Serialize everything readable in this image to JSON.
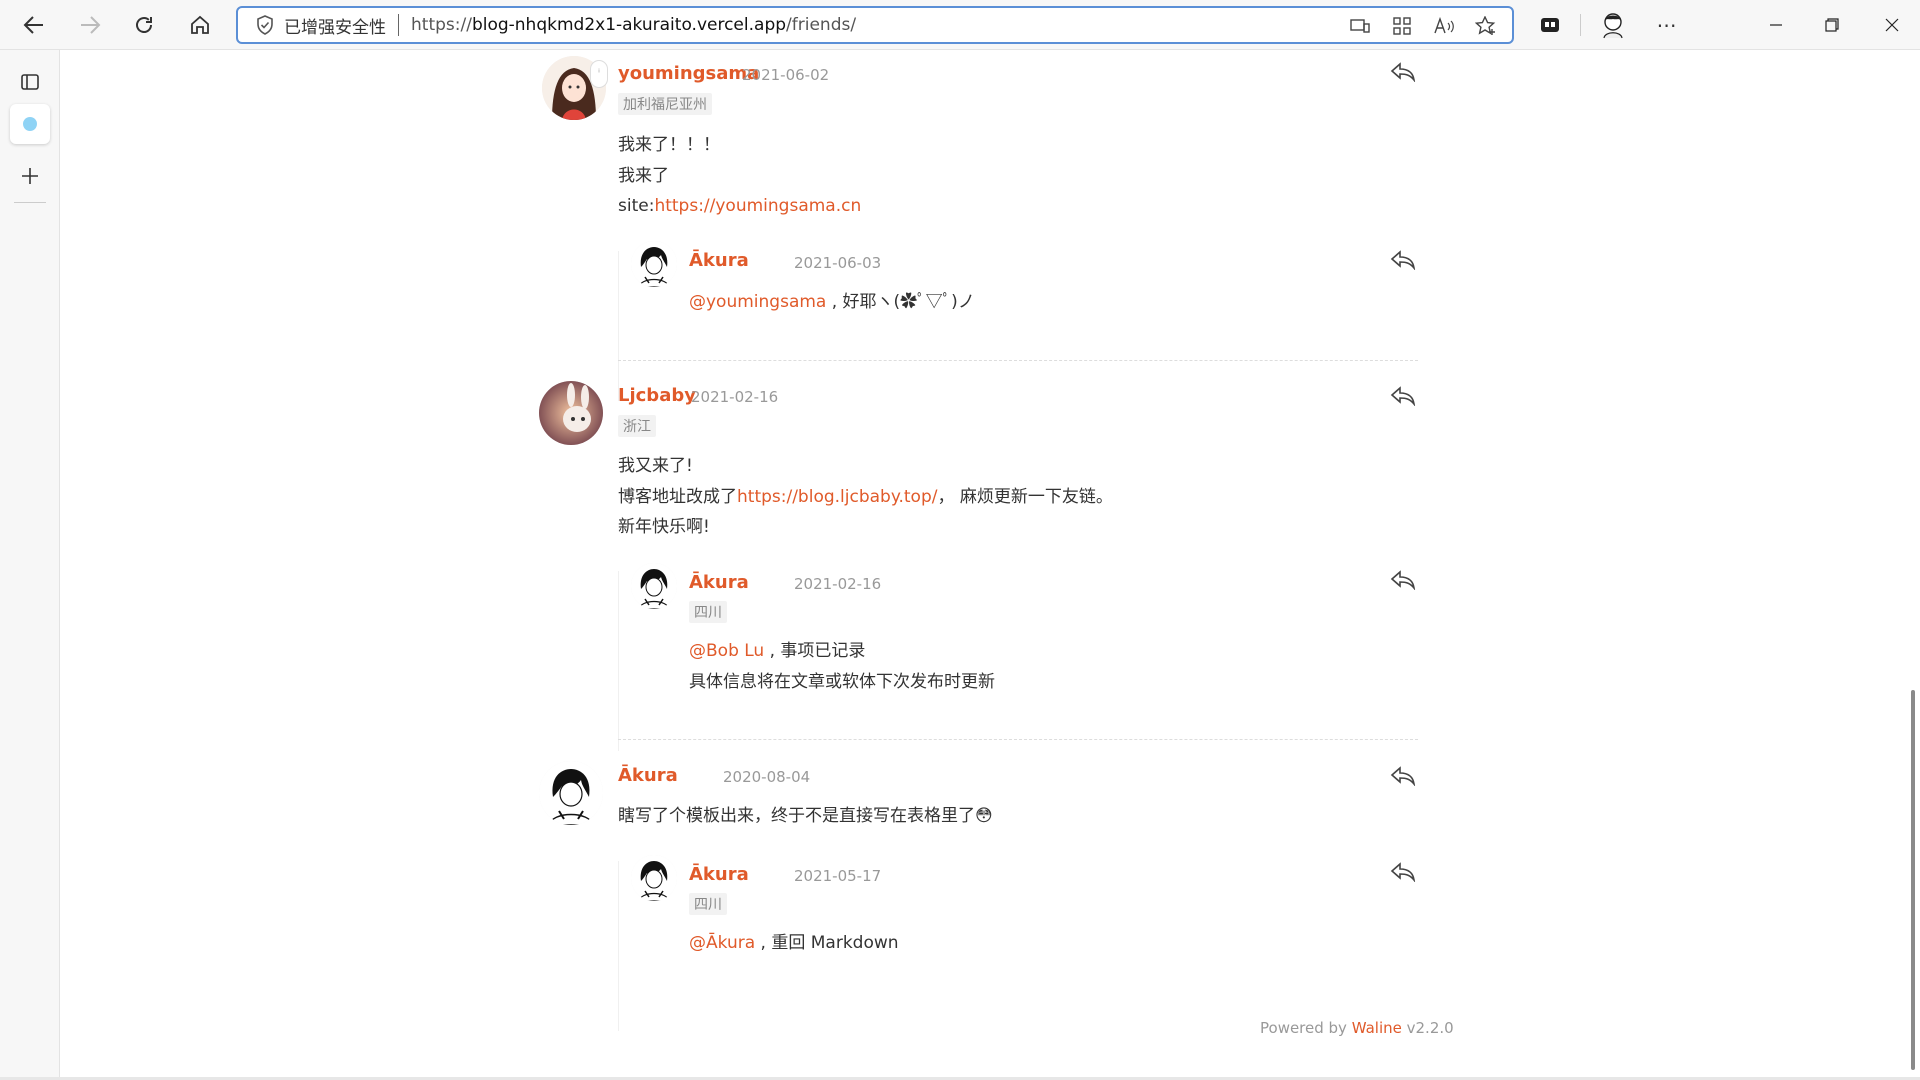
{
  "browser": {
    "security_label": "已增强安全性",
    "url_prefix": "https://",
    "url_host": "blog-nhqkmd2x1-akuraito.vercel.app",
    "url_path": "/friends/"
  },
  "comments": [
    {
      "nick": "youmingsama",
      "date": "2021-06-02",
      "location": "加利福尼亚州",
      "lines": [
        "我来了！！！",
        "我来了"
      ],
      "site_label": "site:",
      "site_link": "https://youmingsama.cn",
      "reply": {
        "nick": "Ākura",
        "date": "2021-06-03",
        "mention": "@youmingsama",
        "text": " , 好耶ヽ(✿ﾟ▽ﾟ)ノ"
      }
    },
    {
      "nick": "Ljcbaby",
      "date": "2021-02-16",
      "location": "浙江",
      "line1": "我又来了!",
      "line2_prefix": "博客地址改成了",
      "line2_link": "https://blog.ljcbaby.top/",
      "line2_suffix": "， 麻烦更新一下友链。",
      "line3": "新年快乐啊!",
      "reply": {
        "nick": "Ākura",
        "date": "2021-02-16",
        "location": "四川",
        "mention": "@Bob Lu",
        "text": " , 事项已记录",
        "line2": "具体信息将在文章或软体下次发布时更新"
      }
    },
    {
      "nick": "Ākura",
      "date": "2020-08-04",
      "text": "瞎写了个模板出来，终于不是直接写在表格里了",
      "emoji": "😳",
      "reply": {
        "nick": "Ākura",
        "date": "2021-05-17",
        "location": "四川",
        "mention": "@Ākura",
        "text": " , 重回 Markdown"
      }
    }
  ],
  "footer": {
    "prefix": "Powered by ",
    "brand": "Waline",
    "version": " v2.2.0"
  }
}
